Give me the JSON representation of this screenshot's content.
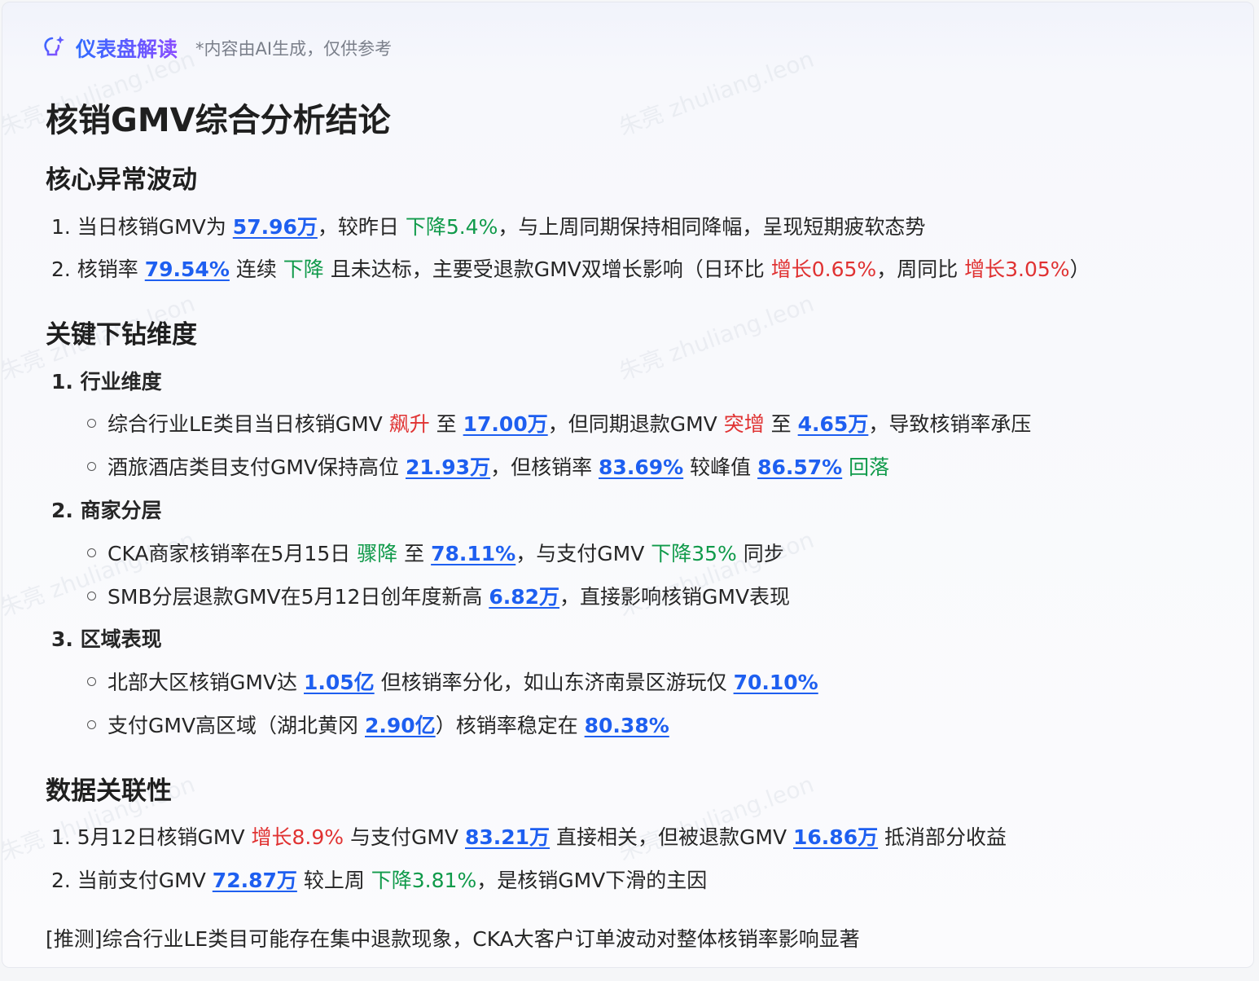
{
  "header": {
    "title": "仪表盘解读",
    "note": "*内容由AI生成，仅供参考",
    "icon": "lightbulb-sparkle-icon"
  },
  "watermark": "朱亮 zhuliang.leon",
  "main_title": "核销GMV综合分析结论",
  "sec1": {
    "title": "核心异常波动",
    "l1": {
      "a": "1. 当日核销GMV为 ",
      "b": "57.96万",
      "c": "，较昨日 ",
      "d": "下降5.4%",
      "e": "，与上周同期保持相同降幅，呈现短期疲软态势"
    },
    "l2": {
      "a": "2. 核销率 ",
      "b": "79.54%",
      "c": " 连续 ",
      "d": "下降",
      "e": " 且未达标，主要受退款GMV双增长影响（日环比 ",
      "f": "增长0.65%",
      "g": "，周同比 ",
      "h": "增长3.05%",
      "i": "）"
    }
  },
  "sec2": {
    "title": "关键下钻维度",
    "g1": "1. 行业维度",
    "g1a": {
      "a": "综合行业LE类目当日核销GMV ",
      "b": "飙升",
      "c": " 至 ",
      "d": "17.00万",
      "e": "，但同期退款GMV ",
      "f": "突增",
      "g": " 至 ",
      "h": "4.65万",
      "i": "，导致核销率承压"
    },
    "g1b": {
      "a": "酒旅酒店类目支付GMV保持高位 ",
      "b": "21.93万",
      "c": "，但核销率 ",
      "d": "83.69%",
      "e": " 较峰值 ",
      "f": "86.57%",
      "g": " ",
      "h": "回落"
    },
    "g2": "2. 商家分层",
    "g2a": {
      "a": "CKA商家核销率在5月15日 ",
      "b": "骤降",
      "c": " 至 ",
      "d": "78.11%",
      "e": "，与支付GMV ",
      "f": "下降35%",
      "g": " 同步"
    },
    "g2b": {
      "a": "SMB分层退款GMV在5月12日创年度新高 ",
      "b": "6.82万",
      "c": "，直接影响核销GMV表现"
    },
    "g3": "3. 区域表现",
    "g3a": {
      "a": "北部大区核销GMV达 ",
      "b": "1.05亿",
      "c": " 但核销率分化，如山东济南景区游玩仅 ",
      "d": "70.10%"
    },
    "g3b": {
      "a": "支付GMV高区域（湖北黄冈 ",
      "b": "2.90亿",
      "c": "）核销率稳定在 ",
      "d": "80.38%"
    }
  },
  "sec3": {
    "title": "数据关联性",
    "l1": {
      "a": "1. 5月12日核销GMV ",
      "b": "增长8.9%",
      "c": " 与支付GMV ",
      "d": "83.21万",
      "e": " 直接相关，但被退款GMV ",
      "f": "16.86万",
      "g": " 抵消部分收益"
    },
    "l2": {
      "a": "2. 当前支付GMV ",
      "b": "72.87万",
      "c": " 较上周 ",
      "d": "下降3.81%",
      "e": "，是核销GMV下滑的主因"
    }
  },
  "footer": "[推测]综合行业LE类目可能存在集中退款现象，CKA大客户订单波动对整体核销率影响显著"
}
